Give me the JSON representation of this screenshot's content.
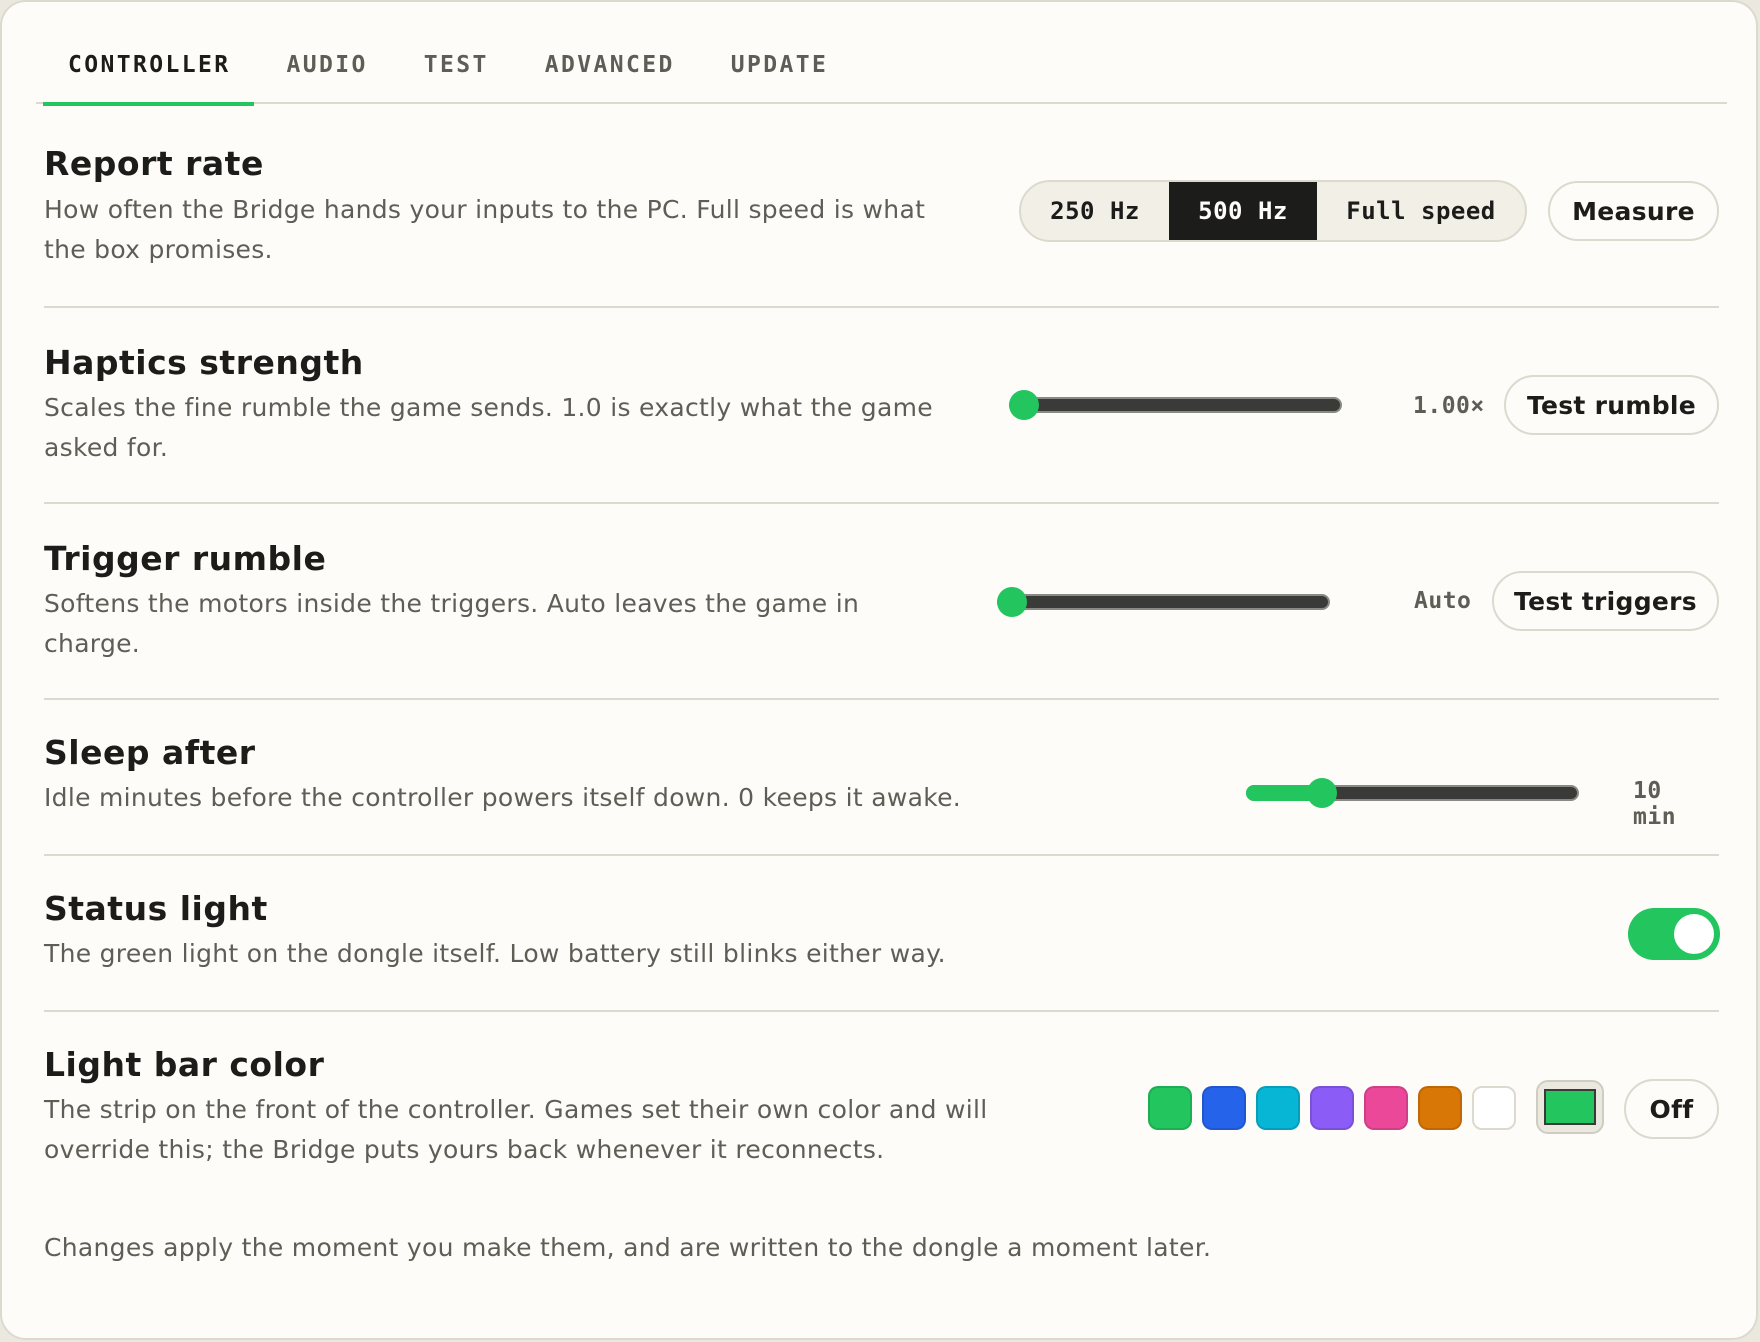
{
  "tabs": [
    {
      "label": "CONTROLLER",
      "active": true
    },
    {
      "label": "AUDIO",
      "active": false
    },
    {
      "label": "TEST",
      "active": false
    },
    {
      "label": "ADVANCED",
      "active": false
    },
    {
      "label": "UPDATE",
      "active": false
    }
  ],
  "accent_color": "#22c55e",
  "report_rate": {
    "title": "Report rate",
    "description": "How often the Bridge hands your inputs to the PC. Full speed is what the box promises.",
    "options": [
      "250 Hz",
      "500 Hz",
      "Full speed"
    ],
    "selected": "500 Hz",
    "measure_label": "Measure"
  },
  "haptics": {
    "title": "Haptics strength",
    "description": "Scales the fine rumble the game sends. 1.0 is exactly what the game asked for.",
    "value_text": "1.00×",
    "slider_fraction": 0.0,
    "button_label": "Test rumble"
  },
  "trigger_rumble": {
    "title": "Trigger rumble",
    "description": "Softens the motors inside the triggers. Auto leaves the game in charge.",
    "value_text": "Auto",
    "slider_fraction": 0.0,
    "button_label": "Test triggers"
  },
  "sleep": {
    "title": "Sleep after",
    "description": "Idle minutes before the controller powers itself down. 0 keeps it awake.",
    "value_text": "10 min",
    "slider_fraction": 0.2
  },
  "status_light": {
    "title": "Status light",
    "description": "The green light on the dongle itself. Low battery still blinks either way.",
    "enabled": true
  },
  "light_bar": {
    "title": "Light bar color",
    "description": "The strip on the front of the controller. Games set their own color and will override this; the Bridge puts yours back whenever it reconnects.",
    "swatches": [
      "#22c55e",
      "#2563eb",
      "#06b6d4",
      "#8b5cf6",
      "#ec4899",
      "#d97706",
      "#ffffff"
    ],
    "custom_color": "#22c55e",
    "off_label": "Off"
  },
  "footer_note": "Changes apply the moment you make them, and are written to the dongle a moment later."
}
